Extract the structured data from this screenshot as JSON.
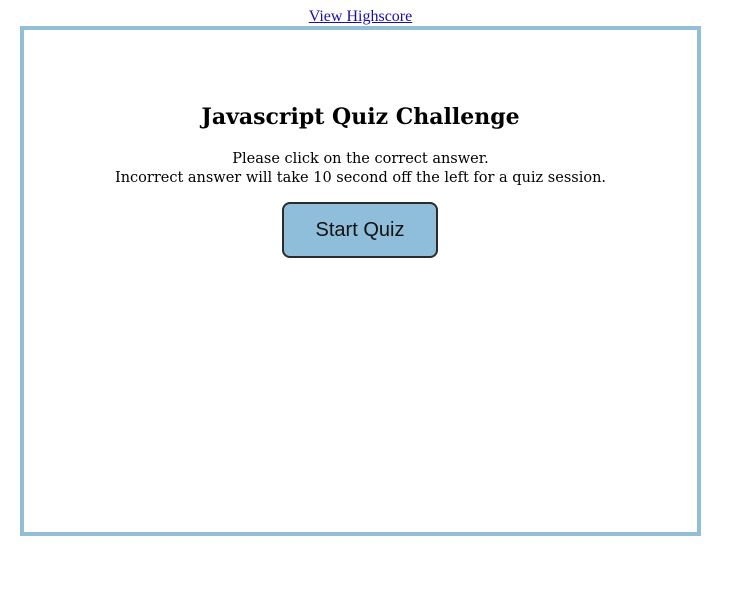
{
  "header": {
    "highscore_link": "View Highscore"
  },
  "quiz": {
    "title": "Javascript Quiz Challenge",
    "instructions": {
      "line1": "Please click on the correct answer.",
      "line2": "Incorrect answer will take 10 second off the left for a quiz session."
    },
    "start_button_label": "Start Quiz"
  },
  "colors": {
    "box_border": "#92bfd6",
    "button_fill": "#8fbedb",
    "link": "#1a0dab"
  }
}
